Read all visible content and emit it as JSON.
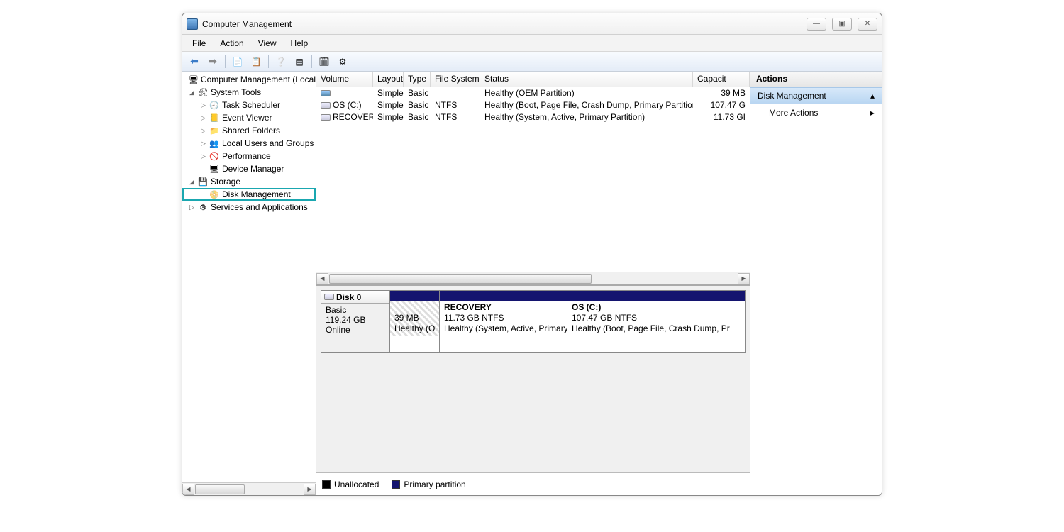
{
  "title": "Computer Management",
  "menus": [
    "File",
    "Action",
    "View",
    "Help"
  ],
  "tree": {
    "root": "Computer Management (Local",
    "systemTools": "System Tools",
    "taskScheduler": "Task Scheduler",
    "eventViewer": "Event Viewer",
    "sharedFolders": "Shared Folders",
    "localUsers": "Local Users and Groups",
    "performance": "Performance",
    "deviceManager": "Device Manager",
    "storage": "Storage",
    "diskManagement": "Disk Management",
    "services": "Services and Applications"
  },
  "columns": {
    "volume": "Volume",
    "layout": "Layout",
    "type": "Type",
    "fs": "File System",
    "status": "Status",
    "capacity": "Capacit"
  },
  "volumes": [
    {
      "name": "",
      "layout": "Simple",
      "type": "Basic",
      "fs": "",
      "status": "Healthy (OEM Partition)",
      "cap": "39 MB"
    },
    {
      "name": "OS (C:)",
      "layout": "Simple",
      "type": "Basic",
      "fs": "NTFS",
      "status": "Healthy (Boot, Page File, Crash Dump, Primary Partition)",
      "cap": "107.47 G"
    },
    {
      "name": "RECOVERY",
      "layout": "Simple",
      "type": "Basic",
      "fs": "NTFS",
      "status": "Healthy (System, Active, Primary Partition)",
      "cap": "11.73 GI"
    }
  ],
  "disk": {
    "label": "Disk 0",
    "type": "Basic",
    "size": "119.24 GB",
    "status": "Online",
    "parts": [
      {
        "title": "",
        "line1": "39 MB",
        "line2": "Healthy (O"
      },
      {
        "title": "RECOVERY",
        "line1": "11.73 GB NTFS",
        "line2": "Healthy (System, Active, Primary"
      },
      {
        "title": "OS  (C:)",
        "line1": "107.47 GB NTFS",
        "line2": "Healthy (Boot, Page File, Crash Dump, Pr"
      }
    ]
  },
  "legend": {
    "unallocated": "Unallocated",
    "primary": "Primary partition"
  },
  "actions": {
    "header": "Actions",
    "diskMgmt": "Disk Management",
    "more": "More Actions"
  }
}
